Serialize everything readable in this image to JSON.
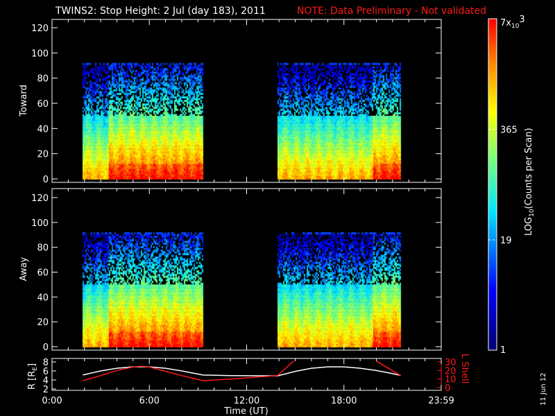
{
  "title": {
    "main": "TWINS2: Stop Height:  2 Jul (day 183), 2011",
    "note": "NOTE: Data Preliminary - Not validated"
  },
  "stamp": "11 Jun 12",
  "colors": {
    "note": "#ff1a1a",
    "r_line": "#ffffff",
    "l_line": "#ff1a1a",
    "axis": "#ffffff"
  },
  "chart_data": [
    {
      "type": "heatmap",
      "name": "Toward",
      "ylabel": "Toward",
      "ylim": [
        -3,
        127
      ],
      "yticks": [
        "0",
        "20",
        "40",
        "60",
        "80",
        "100",
        "120"
      ],
      "xlim_hours": [
        0,
        24
      ],
      "data_max_y": 92,
      "data_blocks_hours": [
        [
          1.9,
          9.3
        ],
        [
          13.9,
          21.5
        ]
      ],
      "high_count_bands_hours": [
        [
          3.5,
          9.3
        ],
        [
          19.8,
          21.5
        ]
      ]
    },
    {
      "type": "heatmap",
      "name": "Away",
      "ylabel": "Away",
      "ylim": [
        -3,
        127
      ],
      "yticks": [
        "0",
        "20",
        "40",
        "60",
        "80",
        "100",
        "120"
      ],
      "xlim_hours": [
        0,
        24
      ],
      "data_max_y": 92,
      "data_blocks_hours": [
        [
          1.9,
          9.3
        ],
        [
          13.9,
          21.5
        ]
      ],
      "high_count_bands_hours": [
        [
          3.5,
          9.3
        ],
        [
          19.8,
          21.5
        ]
      ]
    },
    {
      "type": "line",
      "name": "orbit",
      "ylabel_left": "R [R",
      "ylabel_left_sub": "E",
      "ylabel_left_end": "]",
      "ylabel_right": "L Shell",
      "ylim_left": [
        2,
        8
      ],
      "ylim_right": [
        0,
        30
      ],
      "yticks_left": [
        "2",
        "4",
        "6",
        "8"
      ],
      "yticks_right": [
        "0",
        "10",
        "20",
        "30"
      ],
      "xlabel": "Time (UT)",
      "xticks": [
        {
          "h": 0,
          "label": "0:00"
        },
        {
          "h": 6,
          "label": "6:00"
        },
        {
          "h": 12,
          "label": "12:00"
        },
        {
          "h": 18,
          "label": "18:00"
        },
        {
          "h": 24,
          "label": "23:59"
        }
      ],
      "series": [
        {
          "name": "R",
          "axis": "left",
          "x": [
            1.9,
            3,
            4,
            5,
            6,
            7,
            8,
            9.3,
            11,
            13.9,
            15,
            16,
            17,
            18,
            19,
            20,
            21,
            21.5
          ],
          "y": [
            5.1,
            6.0,
            6.6,
            6.9,
            6.9,
            6.6,
            6.0,
            5.1,
            4.95,
            4.9,
            5.9,
            6.6,
            6.9,
            6.9,
            6.6,
            6.1,
            5.4,
            5.0
          ]
        },
        {
          "name": "L Shell",
          "axis": "right",
          "x": [
            1.9,
            3,
            4,
            5,
            5.5,
            6,
            7,
            8,
            9.3,
            11,
            13.9,
            14.9,
            null,
            20.0,
            21.5
          ],
          "y": [
            8,
            14,
            20,
            24,
            25,
            24,
            19,
            14,
            8,
            10,
            14,
            31,
            null,
            31,
            14
          ]
        }
      ]
    },
    {
      "type": "colorbar",
      "label": "LOG",
      "label_sub": "10",
      "label_end": "(Counts per Scan)",
      "range": [
        1,
        7000
      ],
      "ticks": [
        {
          "value": 1,
          "label": "1"
        },
        {
          "value": 19,
          "label": "19"
        },
        {
          "value": 365,
          "label": "365"
        },
        {
          "value": 7000,
          "label": "7x",
          "label_sub": "10",
          "label_sup": "3"
        }
      ]
    }
  ]
}
